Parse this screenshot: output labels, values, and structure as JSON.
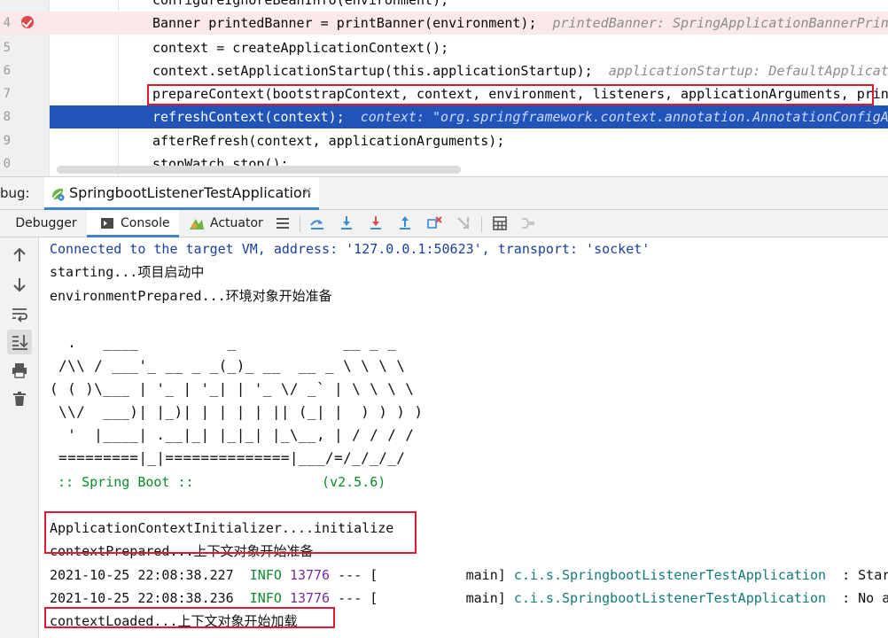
{
  "editor": {
    "lines": [
      {
        "num": "",
        "code": "configureIgnoreBeanInfo(environment);",
        "hint": ""
      },
      {
        "num": "4",
        "code": "Banner printedBanner = printBanner(environment);",
        "hint": "printedBanner: SpringApplicationBannerPrin"
      },
      {
        "num": "5",
        "code": "context = createApplicationContext();",
        "hint": ""
      },
      {
        "num": "6",
        "code": "context.setApplicationStartup(this.applicationStartup);",
        "hint": "applicationStartup: DefaultApplicat"
      },
      {
        "num": "7",
        "code": "prepareContext(bootstrapContext, context, environment, listeners, applicationArguments, prin",
        "hint": ""
      },
      {
        "num": "8",
        "code": "refreshContext(context);",
        "hint": "context: \"org.springframework.context.annotation.AnnotationConfigA"
      },
      {
        "num": "9",
        "code": "afterRefresh(context, applicationArguments);",
        "hint": ""
      },
      {
        "num": "0",
        "code": "stopWatch.stop();",
        "hint": ""
      }
    ]
  },
  "debug": {
    "label": "bug:",
    "session_name": "SpringbootListenerTestApplication",
    "close_glyph": "×"
  },
  "toolbar": {
    "debugger_label": "Debugger",
    "console_label": "Console",
    "actuator_label": "Actuator"
  },
  "console": {
    "connected": "Connected to the target VM, address: '127.0.0.1:50623', transport: 'socket'",
    "starting": "starting...项目启动中",
    "env_prepared": "environmentPrepared...环境对象开始准备",
    "banner": [
      "  .   ____          _            __ _ _",
      " /\\\\ / ___'_ __ _ _(_)_ __  __ _ \\ \\ \\ \\",
      "( ( )\\___ | '_ | '_| | '_ \\/ _` | \\ \\ \\ \\",
      " \\\\/  ___)| |_)| | | | | || (_| |  ) ) ) )",
      "  '  |____| .__|_| |_|_| |_\\__, | / / / /",
      " =========|_|==============|___/=/_/_/_/"
    ],
    "spring_boot": " :: Spring Boot ::                (v2.5.6)",
    "initializer": "ApplicationContextInitializer....initialize",
    "context_prepared": "contextPrepared...上下文对象开始准备",
    "log_lines": [
      {
        "date": "2021-10-25 22:08:38.227",
        "level": "INFO",
        "pid": "13776",
        "thread": "--- [           main]",
        "logger": "c.i.s.SpringbootListenerTestApplication",
        "msg": "  : Star"
      },
      {
        "date": "2021-10-25 22:08:38.236",
        "level": "INFO",
        "pid": "13776",
        "thread": "--- [           main]",
        "logger": "c.i.s.SpringbootListenerTestApplication",
        "msg": "  : No a"
      }
    ],
    "context_loaded": "contextLoaded...上下文对象开始加载"
  },
  "colors": {
    "execution_line": "#2154b8",
    "breakpoint_line": "#fbe9e9",
    "annotation_box": "#e0192e",
    "console_link": "#1a3f9e",
    "log_info": "#0f8a2c"
  }
}
